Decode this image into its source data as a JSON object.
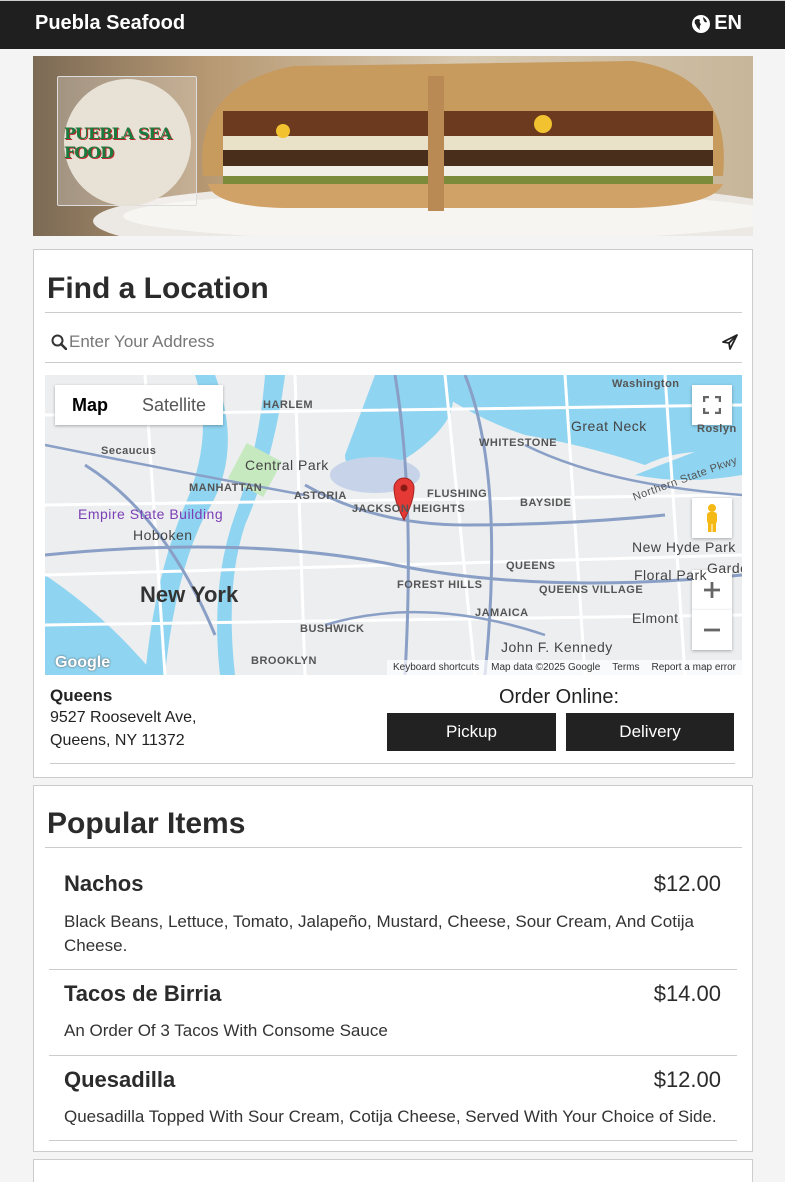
{
  "header": {
    "brand": "Puebla Seafood",
    "language": "EN",
    "globe_icon": "globe-icon"
  },
  "hero": {
    "logo_text": "PUEBLA SEA FOOD"
  },
  "locations": {
    "title": "Find a Location",
    "search": {
      "placeholder": "Enter Your Address",
      "value": ""
    },
    "map": {
      "map_label": "Map",
      "satellite_label": "Satellite",
      "places": [
        "Washington",
        "HARLEM",
        "WHITESTONE",
        "Great Neck",
        "Roslyn",
        "Secaucus",
        "Central Park",
        "MANHATTAN",
        "ASTORIA",
        "FLUSHING",
        "BAYSIDE",
        "Empire State Building",
        "JACKSON HEIGHTS",
        "Hoboken",
        "QUEENS",
        "New Hyde Park",
        "Floral Park",
        "New York",
        "FOREST HILLS",
        "QUEENS VILLAGE",
        "JAMAICA",
        "Elmont",
        "BUSHWICK",
        "BROOKLYN",
        "John F. Kennedy",
        "Garden",
        "Northern State Pkwy"
      ],
      "attribution": [
        "Keyboard shortcuts",
        "Map data ©2025 Google",
        "Terms",
        "Report a map error"
      ],
      "google": "Google"
    },
    "store": {
      "name": "Queens",
      "address_line1": "9527 Roosevelt Ave,",
      "address_line2": "Queens, NY 11372"
    },
    "order": {
      "label": "Order Online:",
      "pickup": "Pickup",
      "delivery": "Delivery"
    }
  },
  "popular": {
    "title": "Popular Items",
    "items": [
      {
        "name": "Nachos",
        "price": "$12.00",
        "description": "Black Beans, Lettuce, Tomato, Jalapeño, Mustard, Cheese, Sour Cream, And Cotija Cheese."
      },
      {
        "name": "Tacos de Birria",
        "price": "$14.00",
        "description": "An Order Of 3 Tacos With Consome Sauce"
      },
      {
        "name": "Quesadilla",
        "price": "$12.00",
        "description": "Quesadilla Topped With Sour Cream, Cotija Cheese, Served With Your Choice of Side."
      }
    ]
  }
}
